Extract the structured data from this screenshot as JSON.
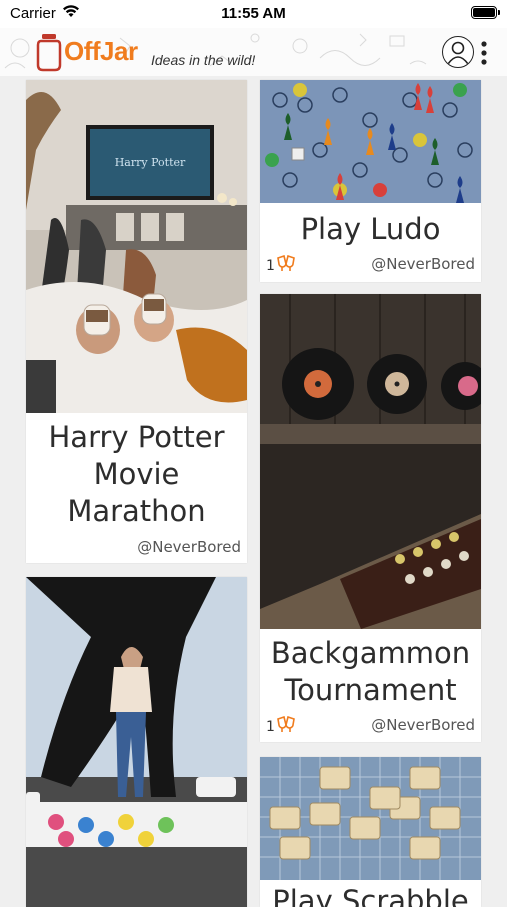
{
  "status_bar": {
    "carrier": "Carrier",
    "time": "11:55 AM"
  },
  "header": {
    "app_name": "OffJar",
    "tagline": "Ideas in the wild!"
  },
  "colors": {
    "accent": "#f07c1e",
    "text": "#2d2d2d",
    "background": "#efefef"
  },
  "cards": [
    {
      "title_lines": [
        "Harry Potter",
        "Movie",
        "Marathon"
      ],
      "author": "@NeverBored",
      "image_icon": "harry-potter-tv-photo"
    },
    {
      "title": "Play Ludo",
      "likes": "1",
      "author": "@NeverBored",
      "image_icon": "ludo-board-photo"
    },
    {
      "title_lines": [
        "Backgammon",
        "Tournament"
      ],
      "likes": "1",
      "author": "@NeverBored",
      "image_icon": "vinyl-backgammon-photo"
    },
    {
      "title": "",
      "image_icon": "twister-rooftop-photo"
    },
    {
      "title": "Play Scrabble",
      "image_icon": "scrabble-tiles-photo"
    }
  ]
}
